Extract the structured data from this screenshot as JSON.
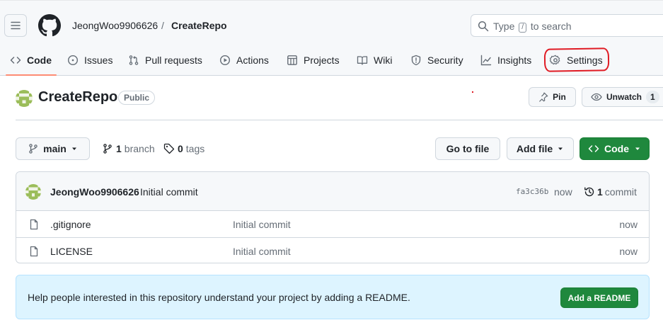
{
  "header": {
    "owner": "JeongWoo9906626",
    "separator": "/",
    "repo": "CreateRepo",
    "search": {
      "prefix": "Type",
      "key": "/",
      "suffix": "to search"
    }
  },
  "tabs": [
    {
      "label": "Code",
      "icon": "code-icon"
    },
    {
      "label": "Issues",
      "icon": "issue-icon"
    },
    {
      "label": "Pull requests",
      "icon": "pull-request-icon"
    },
    {
      "label": "Actions",
      "icon": "play-icon"
    },
    {
      "label": "Projects",
      "icon": "table-icon"
    },
    {
      "label": "Wiki",
      "icon": "book-icon"
    },
    {
      "label": "Security",
      "icon": "shield-icon"
    },
    {
      "label": "Insights",
      "icon": "graph-icon"
    },
    {
      "label": "Settings",
      "icon": "gear-icon"
    }
  ],
  "repo": {
    "title": "CreateRepo",
    "visibility": "Public",
    "pin_label": "Pin",
    "watch_label": "Unwatch",
    "watch_count": "1"
  },
  "branch_bar": {
    "branch": "main",
    "branch_count": "1",
    "branch_word": "branch",
    "tag_count": "0",
    "tag_word": "tags",
    "goto_file": "Go to file",
    "add_file": "Add file",
    "code": "Code"
  },
  "latest_commit": {
    "author": "JeongWoo9906626",
    "message": "Initial commit",
    "sha": "fa3c36b",
    "time": "now",
    "count": "1",
    "count_word": "commit"
  },
  "files": [
    {
      "name": ".gitignore",
      "message": "Initial commit",
      "time": "now"
    },
    {
      "name": "LICENSE",
      "message": "Initial commit",
      "time": "now"
    }
  ],
  "readme_banner": {
    "text": "Help people interested in this repository understand your project by adding a README.",
    "button": "Add a README"
  },
  "colors": {
    "primary_green": "#1f883d",
    "tab_underline": "#fd8c73",
    "annotation_red": "#e01b24",
    "banner_bg": "#ddf4ff"
  }
}
